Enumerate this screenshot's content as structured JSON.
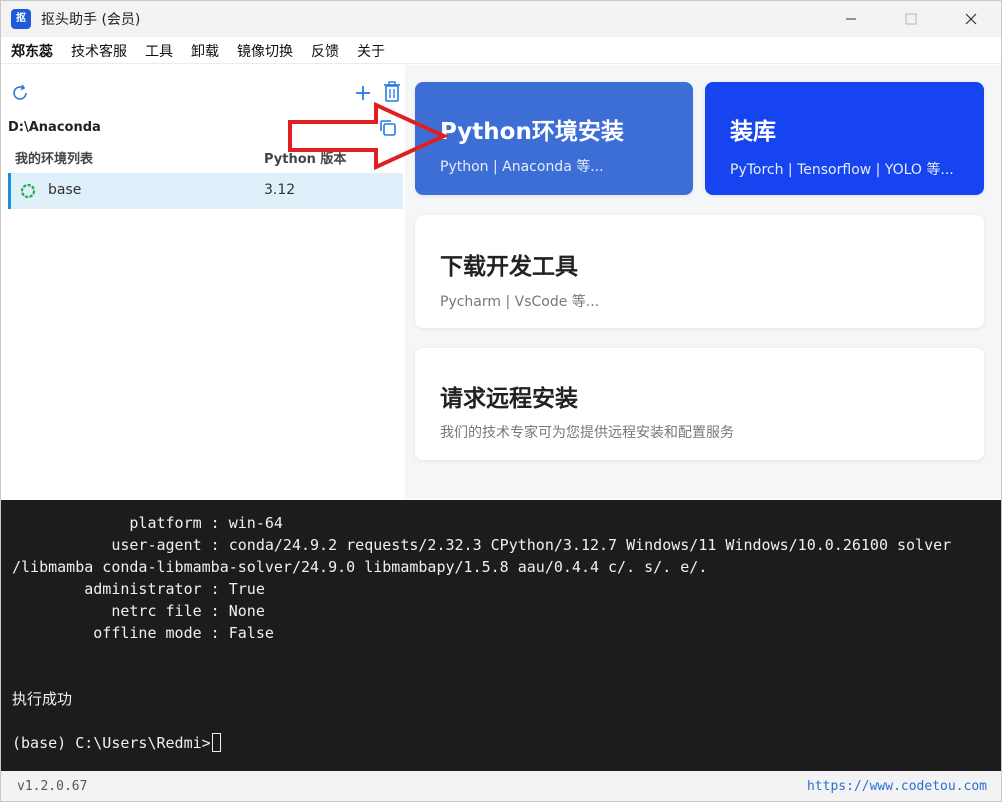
{
  "window": {
    "title": "抠头助手 (会员)",
    "app_icon_text": "抠"
  },
  "menu": {
    "user": "郑东蕊",
    "items": [
      "技术客服",
      "工具",
      "卸载",
      "镜像切换",
      "反馈",
      "关于"
    ]
  },
  "env_panel": {
    "path": "D:\\Anaconda",
    "header_name": "我的环境列表",
    "header_version": "Python 版本",
    "rows": [
      {
        "name": "base",
        "version": "3.12"
      }
    ]
  },
  "cards": {
    "python": {
      "title": "Python环境安装",
      "subtitle": "Python | Anaconda 等..."
    },
    "libs": {
      "title": "装库",
      "subtitle": "PyTorch | Tensorflow | YOLO 等..."
    },
    "tools": {
      "title": "下载开发工具",
      "subtitle": "Pycharm | VsCode 等..."
    },
    "remote": {
      "title": "请求远程安装",
      "subtitle": "我们的技术专家可为您提供远程安装和配置服务"
    }
  },
  "terminal": {
    "lines": [
      "             platform : win-64",
      "           user-agent : conda/24.9.2 requests/2.32.3 CPython/3.12.7 Windows/11 Windows/10.0.26100 solver",
      "/libmamba conda-libmamba-solver/24.9.0 libmambapy/1.5.8 aau/0.4.4 c/. s/. e/.",
      "        administrator : True",
      "           netrc file : None",
      "         offline mode : False",
      "",
      "执行成功",
      "",
      "(base) C:\\Users\\Redmi>"
    ]
  },
  "status": {
    "version": "v1.2.0.67",
    "site": "https://www.codetou.com"
  },
  "colors": {
    "python_card": "#3c6ed6",
    "libs_card": "#1644f0",
    "selected_row": "#dff0fb",
    "accent": "#1a8ed8",
    "annotation_arrow": "#e02020",
    "terminal_bg": "#1c1c1c"
  }
}
